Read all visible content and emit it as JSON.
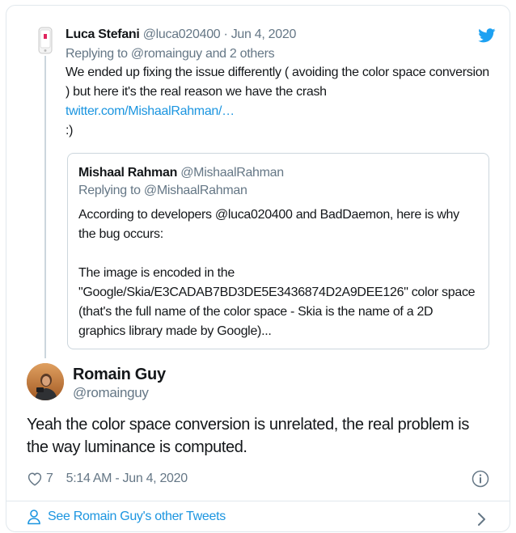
{
  "parent_tweet": {
    "name": "Luca Stefani",
    "handle": "@luca020400",
    "separator": " · ",
    "date": "Jun 4, 2020",
    "replying_to": "Replying to @romainguy and 2 others",
    "text_1": "We ended up fixing the issue differently ( avoiding the color space conversion ) but here it's the real reason we have the crash",
    "link": "twitter.com/MishaalRahman/…",
    "text_2": ":)"
  },
  "quoted_tweet": {
    "name": "Mishaal Rahman",
    "handle": "@MishaalRahman",
    "replying_to": "Replying to @MishaalRahman",
    "paragraph_1": "According to developers @luca020400 and BadDaemon, here is why the bug occurs:",
    "paragraph_2": "The image is encoded in the \"Google/Skia/E3CADAB7BD3DE5E3436874D2A9DEE126\" color space (that's the full name of the color space - Skia is the name of a 2D graphics library made by Google)..."
  },
  "main_tweet": {
    "name": "Romain Guy",
    "handle": "@romainguy",
    "text": "Yeah the color space conversion is unrelated, the real problem is the way luminance is computed.",
    "like_count": "7",
    "timestamp": "5:14 AM - Jun 4, 2020"
  },
  "footer": {
    "label": "See Romain Guy's other Tweets"
  },
  "icons": {
    "brand": "twitter-bird-icon",
    "like": "heart-icon",
    "info": "info-icon",
    "profile": "person-icon",
    "more": "chevron-right-icon"
  },
  "colors": {
    "link": "#1b95e0",
    "twitter_blue": "#1da1f2",
    "secondary_text": "#657786",
    "border": "#e1e8ed"
  }
}
